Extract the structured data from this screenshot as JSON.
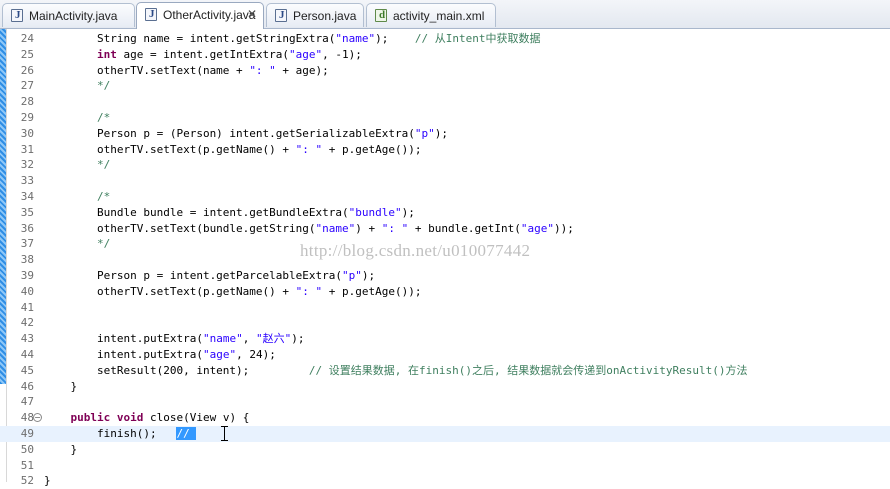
{
  "tabs": [
    {
      "label": "MainActivity.java",
      "icon": "java-file-icon",
      "active": false
    },
    {
      "label": "OtherActivity.java",
      "icon": "java-file-icon",
      "active": true,
      "close": "✕"
    },
    {
      "label": "Person.java",
      "icon": "java-file-icon",
      "active": false
    },
    {
      "label": "activity_main.xml",
      "icon": "xml-file-icon",
      "active": false
    }
  ],
  "editor": {
    "current_line": 49,
    "watermark": "http://blog.csdn.net/u010077442",
    "lines": [
      {
        "n": "24",
        "text": "        String name = intent.getStringExtra(\"name\");    // 从Intent中获取数据"
      },
      {
        "n": "25",
        "text": "        int age = intent.getIntExtra(\"age\", -1);"
      },
      {
        "n": "26",
        "text": "        otherTV.setText(name + \": \" + age);"
      },
      {
        "n": "27",
        "text": "        */"
      },
      {
        "n": "28",
        "text": ""
      },
      {
        "n": "29",
        "text": "        /*"
      },
      {
        "n": "30",
        "text": "        Person p = (Person) intent.getSerializableExtra(\"p\");"
      },
      {
        "n": "31",
        "text": "        otherTV.setText(p.getName() + \": \" + p.getAge());"
      },
      {
        "n": "32",
        "text": "        */"
      },
      {
        "n": "33",
        "text": ""
      },
      {
        "n": "34",
        "text": "        /*"
      },
      {
        "n": "35",
        "text": "        Bundle bundle = intent.getBundleExtra(\"bundle\");"
      },
      {
        "n": "36",
        "text": "        otherTV.setText(bundle.getString(\"name\") + \": \" + bundle.getInt(\"age\"));"
      },
      {
        "n": "37",
        "text": "        */"
      },
      {
        "n": "38",
        "text": ""
      },
      {
        "n": "39",
        "text": "        Person p = intent.getParcelableExtra(\"p\");"
      },
      {
        "n": "40",
        "text": "        otherTV.setText(p.getName() + \": \" + p.getAge());"
      },
      {
        "n": "41",
        "text": ""
      },
      {
        "n": "42",
        "text": ""
      },
      {
        "n": "43",
        "text": "        intent.putExtra(\"name\", \"赵六\");"
      },
      {
        "n": "44",
        "text": "        intent.putExtra(\"age\", 24);"
      },
      {
        "n": "45",
        "text": "        setResult(200, intent);         // 设置结果数据, 在finish()之后, 结果数据就会传递到onActivityResult()方法"
      },
      {
        "n": "46",
        "text": "    }"
      },
      {
        "n": "47",
        "text": ""
      },
      {
        "n": "48",
        "text": "    public void close(View v) {"
      },
      {
        "n": "49",
        "text": "        finish();   //"
      },
      {
        "n": "50",
        "text": "    }"
      },
      {
        "n": "51",
        "text": ""
      },
      {
        "n": "52",
        "text": "}"
      }
    ]
  }
}
